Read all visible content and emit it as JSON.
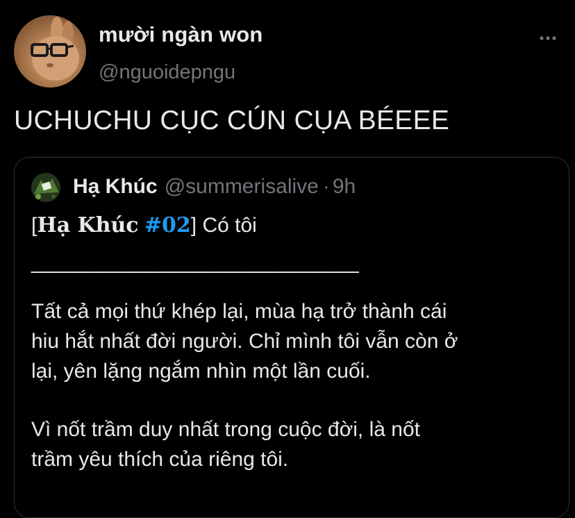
{
  "tweet": {
    "author": {
      "display_name": "mười ngàn won",
      "handle": "@nguoidepngu"
    },
    "text": "UCHUCHU CỤC CÚN CỤA BÉEEE",
    "more_icon": "more-horizontal-icon"
  },
  "quote": {
    "author": {
      "display_name": "Hạ Khúc",
      "handle": "@summerisalive",
      "separator": "·",
      "time": "9h"
    },
    "title": {
      "open_bracket": "[",
      "series": "Hạ Khúc",
      "hashtag": "#02",
      "close_bracket": "]",
      "rest": " Có tôi"
    },
    "divider": "______________________________",
    "paragraph1": [
      "Tất cả mọi thứ khép lại, mùa hạ trở thành cái",
      "hiu hắt nhất đời người. Chỉ mình tôi vẫn còn ở",
      "lại, yên lặng ngắm nhìn một lần cuối."
    ],
    "paragraph2": [
      "Vì nốt trầm duy nhất trong cuộc đời, là nốt",
      "trầm yêu thích của riêng tôi."
    ]
  },
  "colors": {
    "background": "#000000",
    "text_primary": "#e7e9ea",
    "text_secondary": "#71767b",
    "link": "#1d9bf0",
    "border": "#2f3336"
  }
}
